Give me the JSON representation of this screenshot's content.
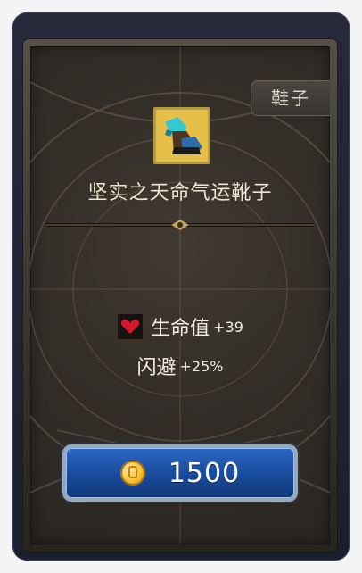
{
  "item": {
    "category": "鞋子",
    "name": "坚实之天命气运靴子",
    "icon": "boots-icon"
  },
  "stats": [
    {
      "label": "生命值",
      "bonus": "+39",
      "icon": "heart-icon"
    },
    {
      "label": "闪避",
      "bonus": "+25%"
    }
  ],
  "purchase": {
    "price": "1500",
    "currency_icon": "gold-coin-icon"
  },
  "colors": {
    "panel_background": "#332e28",
    "buy_button": "#184b9b",
    "text_primary": "#efe6cf"
  }
}
